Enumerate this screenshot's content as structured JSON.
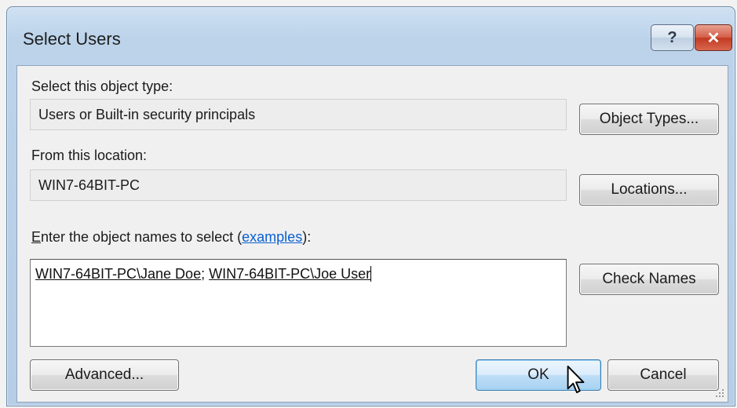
{
  "window": {
    "title": "Select Users",
    "help_label": "?",
    "close_label": "✕"
  },
  "object_type": {
    "label": "Select this object type:",
    "value": "Users or Built-in security principals",
    "button": "Object Types..."
  },
  "location": {
    "label": "From this location:",
    "value": "WIN7-64BIT-PC",
    "button": "Locations..."
  },
  "names": {
    "label_accel": "E",
    "label_rest": "nter the object names to select (",
    "examples_link": "examples",
    "label_end": "):",
    "entry1": "WIN7-64BIT-PC\\Jane Doe",
    "separator": "; ",
    "entry2": "WIN7-64BIT-PC\\Joe User",
    "check_button": "Check Names"
  },
  "footer": {
    "advanced": "Advanced...",
    "ok": "OK",
    "cancel": "Cancel"
  },
  "icons": {
    "cursor": "arrow-cursor-icon",
    "grip": "resize-grip-icon"
  }
}
